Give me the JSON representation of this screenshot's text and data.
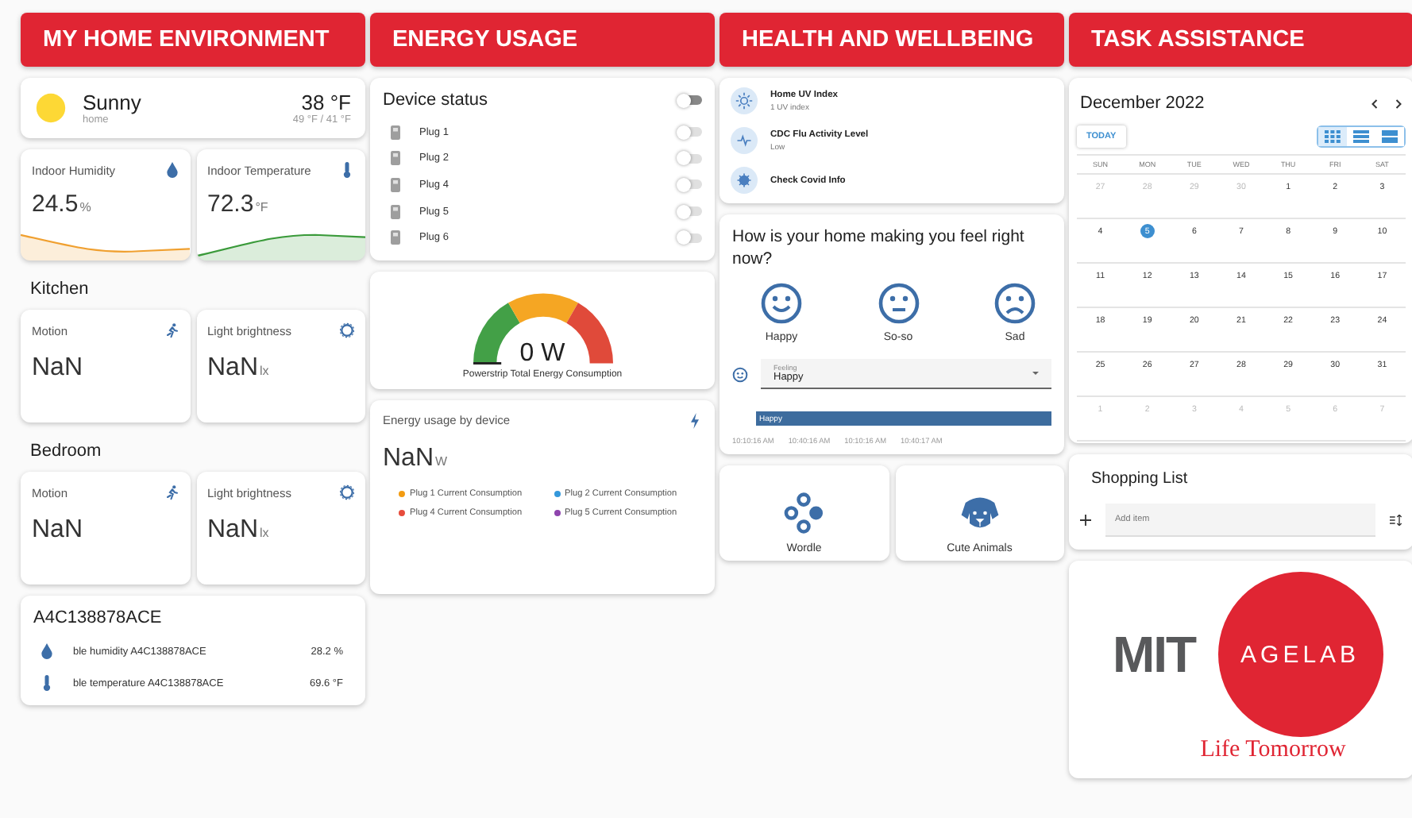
{
  "home": {
    "title": "MY HOME ENVIRONMENT",
    "weather": {
      "condition": "Sunny",
      "location": "home",
      "temperature": "38 °F",
      "range": "49 °F / 41 °F"
    },
    "sensors": [
      {
        "kind": "humidity",
        "label": "Indoor Humidity",
        "value": "24.5",
        "unit": "%",
        "color": "#f0a030"
      },
      {
        "kind": "temperature",
        "label": "Indoor Temperature",
        "value": "72.3",
        "unit": "°F",
        "color": "#3a9a3a"
      }
    ],
    "rooms": [
      {
        "name": "Kitchen",
        "cards": [
          {
            "kind": "motion",
            "label": "Motion",
            "value": "NaN"
          },
          {
            "kind": "light",
            "label": "Light brightness",
            "value": "NaN",
            "unit": "lx"
          }
        ]
      },
      {
        "name": "Bedroom",
        "cards": [
          {
            "kind": "motion",
            "label": "Motion",
            "value": "NaN"
          },
          {
            "kind": "light",
            "label": "Light brightness",
            "value": "NaN",
            "unit": "lx"
          }
        ]
      }
    ],
    "device": {
      "name": "A4C138878ACE",
      "rows": [
        {
          "kind": "humidity",
          "label": "ble humidity A4C138878ACE",
          "value": "28.2 %"
        },
        {
          "kind": "temperature",
          "label": "ble temperature A4C138878ACE",
          "value": "69.6 °F"
        }
      ]
    }
  },
  "energy": {
    "title": "ENERGY USAGE",
    "device_status": {
      "label": "Device status",
      "on": false
    },
    "plugs": [
      {
        "label": "Plug 1",
        "on": false
      },
      {
        "label": "Plug 2",
        "on": false
      },
      {
        "label": "Plug 4",
        "on": false
      },
      {
        "label": "Plug 5",
        "on": false
      },
      {
        "label": "Plug 6",
        "on": false
      }
    ],
    "gauge": {
      "value": "0 W",
      "caption": "Powerstrip Total Energy Consumption"
    },
    "usage": {
      "label": "Energy usage by device",
      "value": "NaN",
      "unit": "W",
      "legend": [
        {
          "label": "Plug 1 Current Consumption",
          "color": "#f39c12"
        },
        {
          "label": "Plug 2 Current Consumption",
          "color": "#3498db"
        },
        {
          "label": "Plug 4 Current Consumption",
          "color": "#e74c3c"
        },
        {
          "label": "Plug 5 Current Consumption",
          "color": "#8e44ad"
        }
      ]
    }
  },
  "health": {
    "title": "HEALTH AND WELLBEING",
    "info": [
      {
        "kind": "uv",
        "title": "Home UV Index",
        "subtitle": "1 UV index"
      },
      {
        "kind": "flu",
        "title": "CDC Flu Activity Level",
        "subtitle": "Low"
      },
      {
        "kind": "covid",
        "title": "Check Covid Info"
      }
    ],
    "mood": {
      "question": "How is your home making you feel right now?",
      "options": [
        {
          "kind": "happy",
          "label": "Happy"
        },
        {
          "kind": "neutral",
          "label": "So-so"
        },
        {
          "kind": "sad",
          "label": "Sad"
        }
      ],
      "select": {
        "label": "Feeling",
        "value": "Happy"
      },
      "timeline": {
        "bar": "Happy",
        "times": [
          "10:10:16 AM",
          "10:40:16 AM",
          "10:10:16 AM",
          "10:40:17 AM"
        ]
      }
    },
    "apps": [
      {
        "kind": "wordle",
        "label": "Wordle"
      },
      {
        "kind": "animals",
        "label": "Cute Animals"
      }
    ]
  },
  "tasks": {
    "title": "TASK ASSISTANCE",
    "calendar": {
      "month": "December 2022",
      "today_button": "TODAY",
      "views": [
        {
          "kind": "month",
          "selected": true
        },
        {
          "kind": "week",
          "selected": false
        },
        {
          "kind": "day",
          "selected": false
        }
      ],
      "weekdays": [
        "SUN",
        "MON",
        "TUE",
        "WED",
        "THU",
        "FRI",
        "SAT"
      ],
      "weeks": [
        [
          {
            "day": "27",
            "muted": true,
            "selected": false
          },
          {
            "day": "28",
            "muted": true,
            "selected": false
          },
          {
            "day": "29",
            "muted": true,
            "selected": false
          },
          {
            "day": "30",
            "muted": true,
            "selected": false
          },
          {
            "day": "1",
            "muted": false,
            "selected": false
          },
          {
            "day": "2",
            "muted": false,
            "selected": false
          },
          {
            "day": "3",
            "muted": false,
            "selected": false
          }
        ],
        [
          {
            "day": "4",
            "muted": false,
            "selected": false
          },
          {
            "day": "5",
            "muted": false,
            "selected": true
          },
          {
            "day": "6",
            "muted": false,
            "selected": false
          },
          {
            "day": "7",
            "muted": false,
            "selected": false
          },
          {
            "day": "8",
            "muted": false,
            "selected": false
          },
          {
            "day": "9",
            "muted": false,
            "selected": false
          },
          {
            "day": "10",
            "muted": false,
            "selected": false
          }
        ],
        [
          {
            "day": "11",
            "muted": false,
            "selected": false
          },
          {
            "day": "12",
            "muted": false,
            "selected": false
          },
          {
            "day": "13",
            "muted": false,
            "selected": false
          },
          {
            "day": "14",
            "muted": false,
            "selected": false
          },
          {
            "day": "15",
            "muted": false,
            "selected": false
          },
          {
            "day": "16",
            "muted": false,
            "selected": false
          },
          {
            "day": "17",
            "muted": false,
            "selected": false
          }
        ],
        [
          {
            "day": "18",
            "muted": false,
            "selected": false
          },
          {
            "day": "19",
            "muted": false,
            "selected": false
          },
          {
            "day": "20",
            "muted": false,
            "selected": false
          },
          {
            "day": "21",
            "muted": false,
            "selected": false
          },
          {
            "day": "22",
            "muted": false,
            "selected": false
          },
          {
            "day": "23",
            "muted": false,
            "selected": false
          },
          {
            "day": "24",
            "muted": false,
            "selected": false
          }
        ],
        [
          {
            "day": "25",
            "muted": false,
            "selected": false
          },
          {
            "day": "26",
            "muted": false,
            "selected": false
          },
          {
            "day": "27",
            "muted": false,
            "selected": false
          },
          {
            "day": "28",
            "muted": false,
            "selected": false
          },
          {
            "day": "29",
            "muted": false,
            "selected": false
          },
          {
            "day": "30",
            "muted": false,
            "selected": false
          },
          {
            "day": "31",
            "muted": false,
            "selected": false
          }
        ],
        [
          {
            "day": "1",
            "muted": true,
            "selected": false
          },
          {
            "day": "2",
            "muted": true,
            "selected": false
          },
          {
            "day": "3",
            "muted": true,
            "selected": false
          },
          {
            "day": "4",
            "muted": true,
            "selected": false
          },
          {
            "day": "5",
            "muted": true,
            "selected": false
          },
          {
            "day": "6",
            "muted": true,
            "selected": false
          },
          {
            "day": "7",
            "muted": true,
            "selected": false
          }
        ]
      ]
    },
    "shopping": {
      "title": "Shopping List",
      "placeholder": "Add item"
    },
    "logo": {
      "mit": "MIT",
      "agelab": "AGELAB",
      "tagline": "Life Tomorrow"
    }
  }
}
